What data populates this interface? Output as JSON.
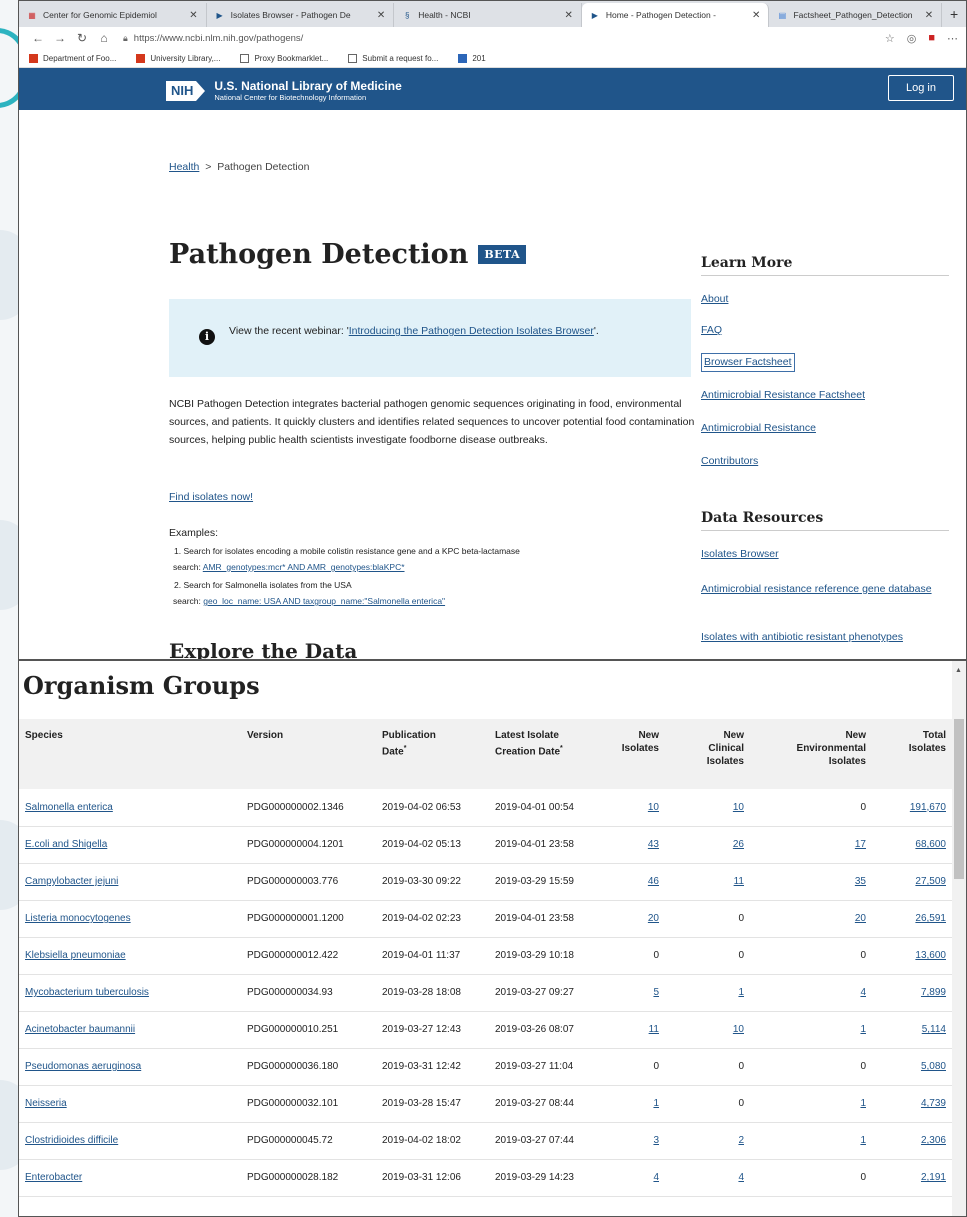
{
  "browser": {
    "tabs": [
      {
        "label": "Center for Genomic Epidemiol",
        "icon": "cge-icon"
      },
      {
        "label": "Isolates Browser - Pathogen De",
        "icon": "pd-icon"
      },
      {
        "label": "Health - NCBI",
        "icon": "ncbi-icon"
      },
      {
        "label": "Home - Pathogen Detection - ",
        "icon": "pd-icon"
      },
      {
        "label": "Factsheet_Pathogen_Detection",
        "icon": "doc-icon"
      }
    ],
    "url": "https://www.ncbi.nlm.nih.gov/pathogens/",
    "bookmarks": [
      "Department of Foo...",
      "University Library,...",
      "Proxy Bookmarklet...",
      "Submit a request fo...",
      "201"
    ]
  },
  "header": {
    "org_short": "NIH",
    "org_name": "U.S. National Library of Medicine",
    "org_sub": "National Center for Biotechnology Information",
    "login": "Log in"
  },
  "breadcrumb": {
    "home": "Health",
    "sep": ">",
    "current": "Pathogen Detection"
  },
  "page": {
    "title": "Pathogen Detection",
    "badge": "BETA",
    "info_prefix": "View the recent webinar: '",
    "info_link": "Introducing the Pathogen Detection Isolates Browser",
    "info_suffix": "'.",
    "description": "NCBI Pathogen Detection integrates bacterial pathogen genomic sequences originating in food, environmental sources, and patients. It quickly clusters and identifies related sequences to uncover potential food contamination sources, helping public health scientists investigate foodborne disease outbreaks.",
    "find_link": "Find isolates now!",
    "examples_label": "Examples:",
    "ex1_text": "1. Search for isolates encoding a mobile colistin resistance gene and a KPC beta-lactamase",
    "ex1_prefix": "search: ",
    "ex1_query": "AMR_genotypes:mcr* AND AMR_genotypes:blaKPC*",
    "ex2_text": "2. Search for Salmonella isolates from the USA",
    "ex2_prefix": "search: ",
    "ex2_query": "geo_loc_name: USA AND taxgroup_name:\"Salmonella enterica\"",
    "explore": "Explore the Data"
  },
  "sidebar": {
    "learn_heading": "Learn More",
    "learn": [
      "About",
      "FAQ",
      "Browser Factsheet",
      "Antimicrobial Resistance Factsheet",
      "Antimicrobial Resistance",
      "Contributors"
    ],
    "data_heading": "Data Resources",
    "data": [
      "Isolates Browser",
      "Antimicrobial resistance reference gene database",
      "Isolates with antibiotic resistant phenotypes"
    ]
  },
  "organisms": {
    "heading": "Organism Groups",
    "columns": {
      "species": "Species",
      "version": "Version",
      "pub1": "Publication",
      "pub2": "Date",
      "lat1": "Latest Isolate",
      "lat2": "Creation Date",
      "new1": "New",
      "new2": "Isolates",
      "cl1": "New",
      "cl2": "Clinical",
      "cl3": "Isolates",
      "env1": "New",
      "env2": "Environmental",
      "env3": "Isolates",
      "tot1": "Total",
      "tot2": "Isolates",
      "star": "*"
    },
    "rows": [
      {
        "species": "Salmonella enterica",
        "version": "PDG000000002.1346",
        "pub": "2019-04-02 06:53",
        "latest": "2019-04-01 00:54",
        "new": "10",
        "clinical": "10",
        "env": "0",
        "total": "191,670"
      },
      {
        "species": "E.coli and Shigella",
        "version": "PDG000000004.1201",
        "pub": "2019-04-02 05:13",
        "latest": "2019-04-01 23:58",
        "new": "43",
        "clinical": "26",
        "env": "17",
        "total": "68,600"
      },
      {
        "species": "Campylobacter jejuni",
        "version": "PDG000000003.776",
        "pub": "2019-03-30 09:22",
        "latest": "2019-03-29 15:59",
        "new": "46",
        "clinical": "11",
        "env": "35",
        "total": "27,509"
      },
      {
        "species": "Listeria monocytogenes",
        "version": "PDG000000001.1200",
        "pub": "2019-04-02 02:23",
        "latest": "2019-04-01 23:58",
        "new": "20",
        "clinical": "0",
        "env": "20",
        "total": "26,591"
      },
      {
        "species": "Klebsiella pneumoniae",
        "version": "PDG000000012.422",
        "pub": "2019-04-01 11:37",
        "latest": "2019-03-29 10:18",
        "new": "0",
        "clinical": "0",
        "env": "0",
        "total": "13,600"
      },
      {
        "species": "Mycobacterium tuberculosis",
        "version": "PDG000000034.93",
        "pub": "2019-03-28 18:08",
        "latest": "2019-03-27 09:27",
        "new": "5",
        "clinical": "1",
        "env": "4",
        "total": "7,899"
      },
      {
        "species": "Acinetobacter baumannii",
        "version": "PDG000000010.251",
        "pub": "2019-03-27 12:43",
        "latest": "2019-03-26 08:07",
        "new": "11",
        "clinical": "10",
        "env": "1",
        "total": "5,114"
      },
      {
        "species": "Pseudomonas aeruginosa",
        "version": "PDG000000036.180",
        "pub": "2019-03-31 12:42",
        "latest": "2019-03-27 11:04",
        "new": "0",
        "clinical": "0",
        "env": "0",
        "total": "5,080"
      },
      {
        "species": "Neisseria",
        "version": "PDG000000032.101",
        "pub": "2019-03-28 15:47",
        "latest": "2019-03-27 08:44",
        "new": "1",
        "clinical": "0",
        "env": "1",
        "total": "4,739"
      },
      {
        "species": "Clostridioides difficile",
        "version": "PDG000000045.72",
        "pub": "2019-04-02 18:02",
        "latest": "2019-03-27 07:44",
        "new": "3",
        "clinical": "2",
        "env": "1",
        "total": "2,306"
      },
      {
        "species": "Enterobacter",
        "version": "PDG000000028.182",
        "pub": "2019-03-31 12:06",
        "latest": "2019-03-29 14:23",
        "new": "4",
        "clinical": "4",
        "env": "0",
        "total": "2,191"
      }
    ]
  },
  "colors": {
    "nih_blue": "#20558a",
    "link": "#20558a",
    "info_bg": "#e1f1f8",
    "accent_teal": "#2cb3c0"
  }
}
